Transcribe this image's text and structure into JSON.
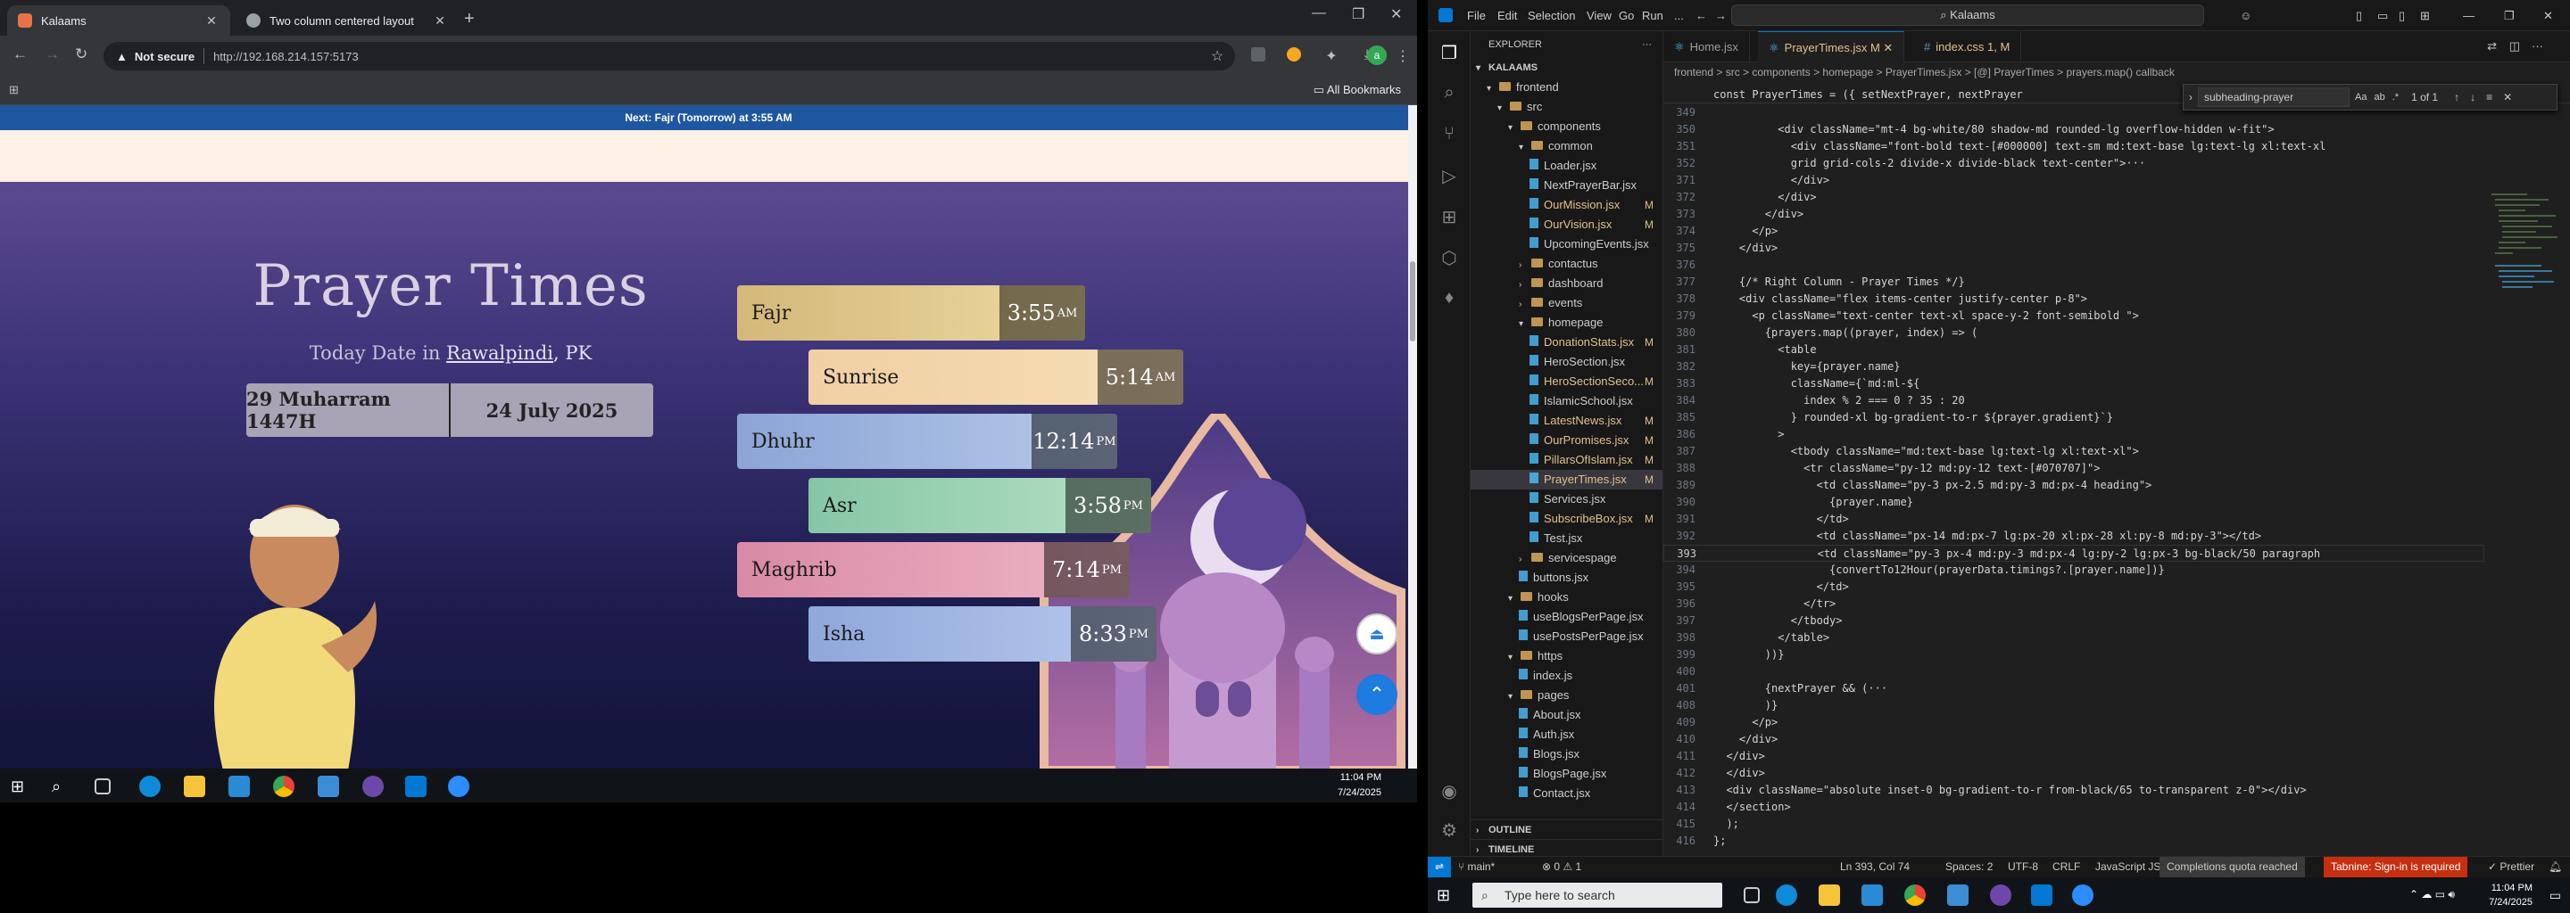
{
  "browser": {
    "tabs": [
      {
        "title": "Kalaams",
        "active": true
      },
      {
        "title": "Two column centered layout",
        "active": false
      }
    ],
    "omnibox": {
      "security": "Not secure",
      "url": "http://192.168.214.157:5173"
    },
    "bookmarks_label": "All Bookmarks"
  },
  "site": {
    "next_prayer_bar": "Next: Fajr (Tomorrow) at 3:55 AM",
    "title": "Prayer Times",
    "date_prefix": "Today Date in",
    "city": "Rawalpindi",
    "country": ", PK",
    "hijri_date": "29 Muharram 1447H",
    "gregorian_date": "24 July 2025",
    "prayers": [
      {
        "name": "Fajr",
        "time": "3:55",
        "ampm": "AM"
      },
      {
        "name": "Sunrise",
        "time": "5:14",
        "ampm": "AM"
      },
      {
        "name": "Dhuhr",
        "time": "12:14",
        "ampm": "PM"
      },
      {
        "name": "Asr",
        "time": "3:58",
        "ampm": "PM"
      },
      {
        "name": "Maghrib",
        "time": "7:14",
        "ampm": "PM"
      },
      {
        "name": "Isha",
        "time": "8:33",
        "ampm": "PM"
      }
    ]
  },
  "left_taskbar_clock": {
    "time": "11:04 PM",
    "date": "7/24/2025"
  },
  "vscode": {
    "menu": [
      "File",
      "Edit",
      "Selection",
      "View",
      "Go",
      "Run",
      "..."
    ],
    "command_center": "Kalaams",
    "explorer_title": "EXPLORER",
    "workspace": "KALAAMS",
    "tree": [
      {
        "label": "frontend",
        "kind": "folder",
        "depth": 1,
        "open": true
      },
      {
        "label": "src",
        "kind": "folder",
        "depth": 2,
        "open": true
      },
      {
        "label": "components",
        "kind": "folder",
        "depth": 3,
        "open": true
      },
      {
        "label": "common",
        "kind": "folder",
        "depth": 4,
        "open": true
      },
      {
        "label": "Loader.jsx",
        "kind": "file",
        "depth": 5
      },
      {
        "label": "NextPrayerBar.jsx",
        "kind": "file",
        "depth": 5
      },
      {
        "label": "OurMission.jsx",
        "kind": "file",
        "depth": 5,
        "mark": "M"
      },
      {
        "label": "OurVision.jsx",
        "kind": "file",
        "depth": 5,
        "mark": "M"
      },
      {
        "label": "UpcomingEvents.jsx",
        "kind": "file",
        "depth": 5
      },
      {
        "label": "contactus",
        "kind": "folder",
        "depth": 4
      },
      {
        "label": "dashboard",
        "kind": "folder",
        "depth": 4
      },
      {
        "label": "events",
        "kind": "folder",
        "depth": 4
      },
      {
        "label": "homepage",
        "kind": "folder",
        "depth": 4,
        "open": true
      },
      {
        "label": "DonationStats.jsx",
        "kind": "file",
        "depth": 5,
        "mark": "M"
      },
      {
        "label": "HeroSection.jsx",
        "kind": "file",
        "depth": 5
      },
      {
        "label": "HeroSectionSeco...",
        "kind": "file",
        "depth": 5,
        "mark": "M"
      },
      {
        "label": "IslamicSchool.jsx",
        "kind": "file",
        "depth": 5
      },
      {
        "label": "LatestNews.jsx",
        "kind": "file",
        "depth": 5,
        "mark": "M"
      },
      {
        "label": "OurPromises.jsx",
        "kind": "file",
        "depth": 5,
        "mark": "M"
      },
      {
        "label": "PillarsOfIslam.jsx",
        "kind": "file",
        "depth": 5,
        "mark": "M"
      },
      {
        "label": "PrayerTimes.jsx",
        "kind": "file",
        "depth": 5,
        "mark": "M",
        "selected": true
      },
      {
        "label": "Services.jsx",
        "kind": "file",
        "depth": 5
      },
      {
        "label": "SubscribeBox.jsx",
        "kind": "file",
        "depth": 5,
        "mark": "M"
      },
      {
        "label": "Test.jsx",
        "kind": "file",
        "depth": 5
      },
      {
        "label": "servicespage",
        "kind": "folder",
        "depth": 4
      },
      {
        "label": "buttons.jsx",
        "kind": "file",
        "depth": 4
      },
      {
        "label": "hooks",
        "kind": "folder",
        "depth": 3,
        "open": true
      },
      {
        "label": "useBlogsPerPage.jsx",
        "kind": "file",
        "depth": 4
      },
      {
        "label": "usePostsPerPage.jsx",
        "kind": "file",
        "depth": 4
      },
      {
        "label": "https",
        "kind": "folder",
        "depth": 3,
        "open": true
      },
      {
        "label": "index.js",
        "kind": "file",
        "depth": 4
      },
      {
        "label": "pages",
        "kind": "folder",
        "depth": 3,
        "open": true
      },
      {
        "label": "About.jsx",
        "kind": "file",
        "depth": 4
      },
      {
        "label": "Auth.jsx",
        "kind": "file",
        "depth": 4
      },
      {
        "label": "Blogs.jsx",
        "kind": "file",
        "depth": 4
      },
      {
        "label": "BlogsPage.jsx",
        "kind": "file",
        "depth": 4
      },
      {
        "label": "Contact.jsx",
        "kind": "file",
        "depth": 4
      }
    ],
    "outline_label": "OUTLINE",
    "timeline_label": "TIMELINE",
    "editor_tabs": [
      {
        "label": "Home.jsx",
        "active": false
      },
      {
        "label": "PrayerTimes.jsx M",
        "active": true
      },
      {
        "label": "index.css 1, M",
        "active": false
      }
    ],
    "breadcrumbs": "frontend > src > components > homepage > PrayerTimes.jsx > [@] PrayerTimes > prayers.map() callback",
    "sticky_line": "const PrayerTimes = ({ setNextPrayer, nextPrayer",
    "find": {
      "query": "subheading-prayer",
      "result": "1 of 1"
    },
    "code_lines": [
      {
        "n": "349",
        "text": ""
      },
      {
        "n": "350",
        "text": "          <div className=\"mt-4 bg-white/80 shadow-md rounded-lg overflow-hidden w-fit\">"
      },
      {
        "n": "351",
        "text": "            <div className=\"font-bold text-[#000000] text-sm md:text-base lg:text-lg xl:text-xl"
      },
      {
        "n": "352",
        "text": "            grid grid-cols-2 divide-x divide-black text-center\">···"
      },
      {
        "n": "371",
        "text": "            </div>"
      },
      {
        "n": "372",
        "text": "          </div>"
      },
      {
        "n": "373",
        "text": "        </div>"
      },
      {
        "n": "374",
        "text": "      </p>"
      },
      {
        "n": "375",
        "text": "    </div>"
      },
      {
        "n": "376",
        "text": ""
      },
      {
        "n": "377",
        "text": "    {/* Right Column - Prayer Times */}"
      },
      {
        "n": "378",
        "text": "    <div className=\"flex items-center justify-center p-8\">"
      },
      {
        "n": "379",
        "text": "      <p className=\"text-center text-xl space-y-2 font-semibold \">"
      },
      {
        "n": "380",
        "text": "        {prayers.map((prayer, index) => ("
      },
      {
        "n": "381",
        "text": "          <table"
      },
      {
        "n": "382",
        "text": "            key={prayer.name}"
      },
      {
        "n": "383",
        "text": "            className={`md:ml-${"
      },
      {
        "n": "384",
        "text": "              index % 2 === 0 ? 35 : 20"
      },
      {
        "n": "385",
        "text": "            } rounded-xl bg-gradient-to-r ${prayer.gradient}`}"
      },
      {
        "n": "386",
        "text": "          >"
      },
      {
        "n": "387",
        "text": "            <tbody className=\"md:text-base lg:text-lg xl:text-xl\">"
      },
      {
        "n": "388",
        "text": "              <tr className=\"py-12 md:py-12 text-[#070707]\">"
      },
      {
        "n": "389",
        "text": "                <td className=\"py-3 px-2.5 md:py-3 md:px-4 heading\">"
      },
      {
        "n": "390",
        "text": "                  {prayer.name}"
      },
      {
        "n": "391",
        "text": "                </td>"
      },
      {
        "n": "392",
        "text": "                <td className=\"px-14 md:px-7 lg:px-20 xl:px-28 xl:py-8 md:py-3\"></td>"
      },
      {
        "n": "393",
        "text": "                <td className=\"py-3 px-4 md:py-3 md:px-4 lg:py-2 lg:px-3 bg-black/50 paragraph"
      },
      {
        "n": "394",
        "text": "                  {convertTo12Hour(prayerData.timings?.[prayer.name])}"
      },
      {
        "n": "395",
        "text": "                </td>"
      },
      {
        "n": "396",
        "text": "              </tr>"
      },
      {
        "n": "397",
        "text": "            </tbody>"
      },
      {
        "n": "398",
        "text": "          </table>"
      },
      {
        "n": "399",
        "text": "        ))}"
      },
      {
        "n": "400",
        "text": ""
      },
      {
        "n": "401",
        "text": "        {nextPrayer && (···"
      },
      {
        "n": "408",
        "text": "        )}"
      },
      {
        "n": "409",
        "text": "      </p>"
      },
      {
        "n": "410",
        "text": "    </div>"
      },
      {
        "n": "411",
        "text": "  </div>"
      },
      {
        "n": "412",
        "text": "  </div>"
      },
      {
        "n": "413",
        "text": "  <div className=\"absolute inset-0 bg-gradient-to-r from-black/65 to-transparent z-0\"></div>"
      },
      {
        "n": "414",
        "text": "  </section>"
      },
      {
        "n": "415",
        "text": "  );"
      },
      {
        "n": "416",
        "text": "};"
      }
    ],
    "status": {
      "branch": "main*",
      "problems": "⊗ 0 ⚠ 1",
      "position": "Ln 393, Col 74",
      "spaces": "Spaces: 2",
      "encoding": "UTF-8",
      "eol": "CRLF",
      "language": "JavaScript JSX",
      "quota": "Completions quota reached",
      "tabnine": "Tabnine: Sign-in is required",
      "prettier": "✓ Prettier"
    }
  },
  "right_taskbar": {
    "search_placeholder": "Type here to search",
    "time": "11:04 PM",
    "date": "7/24/2025"
  },
  "colors": {
    "vscode_blue": "#0078d4",
    "chrome_bg": "#202124",
    "nextbar_blue": "#1e56a0"
  }
}
